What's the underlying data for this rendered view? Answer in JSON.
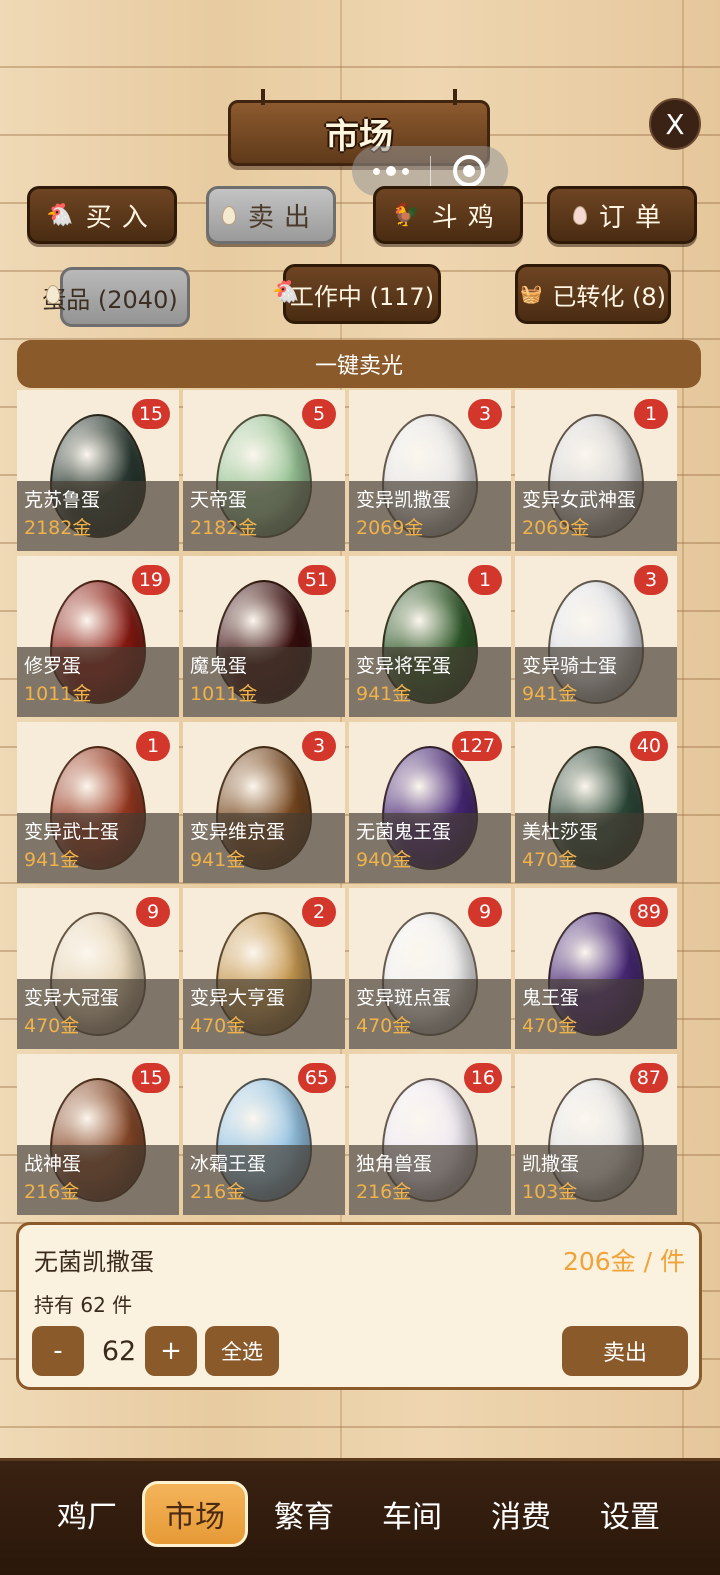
{
  "header": {
    "title": "市场",
    "close_label": "X"
  },
  "tabs": [
    {
      "label": "买入",
      "icon": "hen-icon",
      "active": false
    },
    {
      "label": "卖出",
      "icon": "egg-icon",
      "active": true
    },
    {
      "label": "斗鸡",
      "icon": "rooster-icon",
      "active": false
    },
    {
      "label": "订单",
      "icon": "egg-pink-icon",
      "active": false
    }
  ],
  "subtabs": [
    {
      "label": "蛋品 (2040)",
      "icon": "egg-icon",
      "active": true
    },
    {
      "label": "工作中 (117)",
      "icon": "hen-icon",
      "active": false
    },
    {
      "label": "已转化 (8)",
      "icon": "basket-icon",
      "active": false
    }
  ],
  "sell_all_label": "一键卖光",
  "items": [
    {
      "name": "克苏鲁蛋",
      "price": "2182金",
      "count": "15",
      "color": "#2a3a32"
    },
    {
      "name": "天帝蛋",
      "price": "2182金",
      "count": "5",
      "color": "#9cc89a"
    },
    {
      "name": "变异凯撒蛋",
      "price": "2069金",
      "count": "3",
      "color": "#e8e8e8"
    },
    {
      "name": "变异女武神蛋",
      "price": "2069金",
      "count": "1",
      "color": "#d8d8d8"
    },
    {
      "name": "修罗蛋",
      "price": "1011金",
      "count": "19",
      "color": "#8a1a12"
    },
    {
      "name": "魔鬼蛋",
      "price": "1011金",
      "count": "51",
      "color": "#3a0e0e"
    },
    {
      "name": "变异将军蛋",
      "price": "941金",
      "count": "1",
      "color": "#2f5a2a"
    },
    {
      "name": "变异骑士蛋",
      "price": "941金",
      "count": "3",
      "color": "#e2e4ea"
    },
    {
      "name": "变异武士蛋",
      "price": "941金",
      "count": "1",
      "color": "#9a3a22"
    },
    {
      "name": "变异维京蛋",
      "price": "941金",
      "count": "3",
      "color": "#7a4a22"
    },
    {
      "name": "无菌鬼王蛋",
      "price": "940金",
      "count": "127",
      "color": "#4a2a7a"
    },
    {
      "name": "美杜莎蛋",
      "price": "470金",
      "count": "40",
      "color": "#2e4a3a"
    },
    {
      "name": "变异大冠蛋",
      "price": "470金",
      "count": "9",
      "color": "#e8d6b8"
    },
    {
      "name": "变异大亨蛋",
      "price": "470金",
      "count": "2",
      "color": "#c89a52"
    },
    {
      "name": "变异斑点蛋",
      "price": "470金",
      "count": "9",
      "color": "#f2f2f2"
    },
    {
      "name": "鬼王蛋",
      "price": "470金",
      "count": "89",
      "color": "#4a2a7a"
    },
    {
      "name": "战神蛋",
      "price": "216金",
      "count": "15",
      "color": "#8a4a2a"
    },
    {
      "name": "冰霜王蛋",
      "price": "216金",
      "count": "65",
      "color": "#9ac8e8"
    },
    {
      "name": "独角兽蛋",
      "price": "216金",
      "count": "16",
      "color": "#f0eaf4"
    },
    {
      "name": "凯撒蛋",
      "price": "103金",
      "count": "87",
      "color": "#e6e6e6"
    }
  ],
  "detail": {
    "name": "无菌凯撒蛋",
    "unit_price": "206金 / 件",
    "holding": "持有 62 件",
    "minus": "-",
    "quantity": "62",
    "plus": "+",
    "select_all": "全选",
    "sell": "卖出"
  },
  "nav": [
    {
      "label": "鸡厂",
      "active": false
    },
    {
      "label": "市场",
      "active": true
    },
    {
      "label": "繁育",
      "active": false
    },
    {
      "label": "车间",
      "active": false
    },
    {
      "label": "消费",
      "active": false
    },
    {
      "label": "设置",
      "active": false
    }
  ]
}
